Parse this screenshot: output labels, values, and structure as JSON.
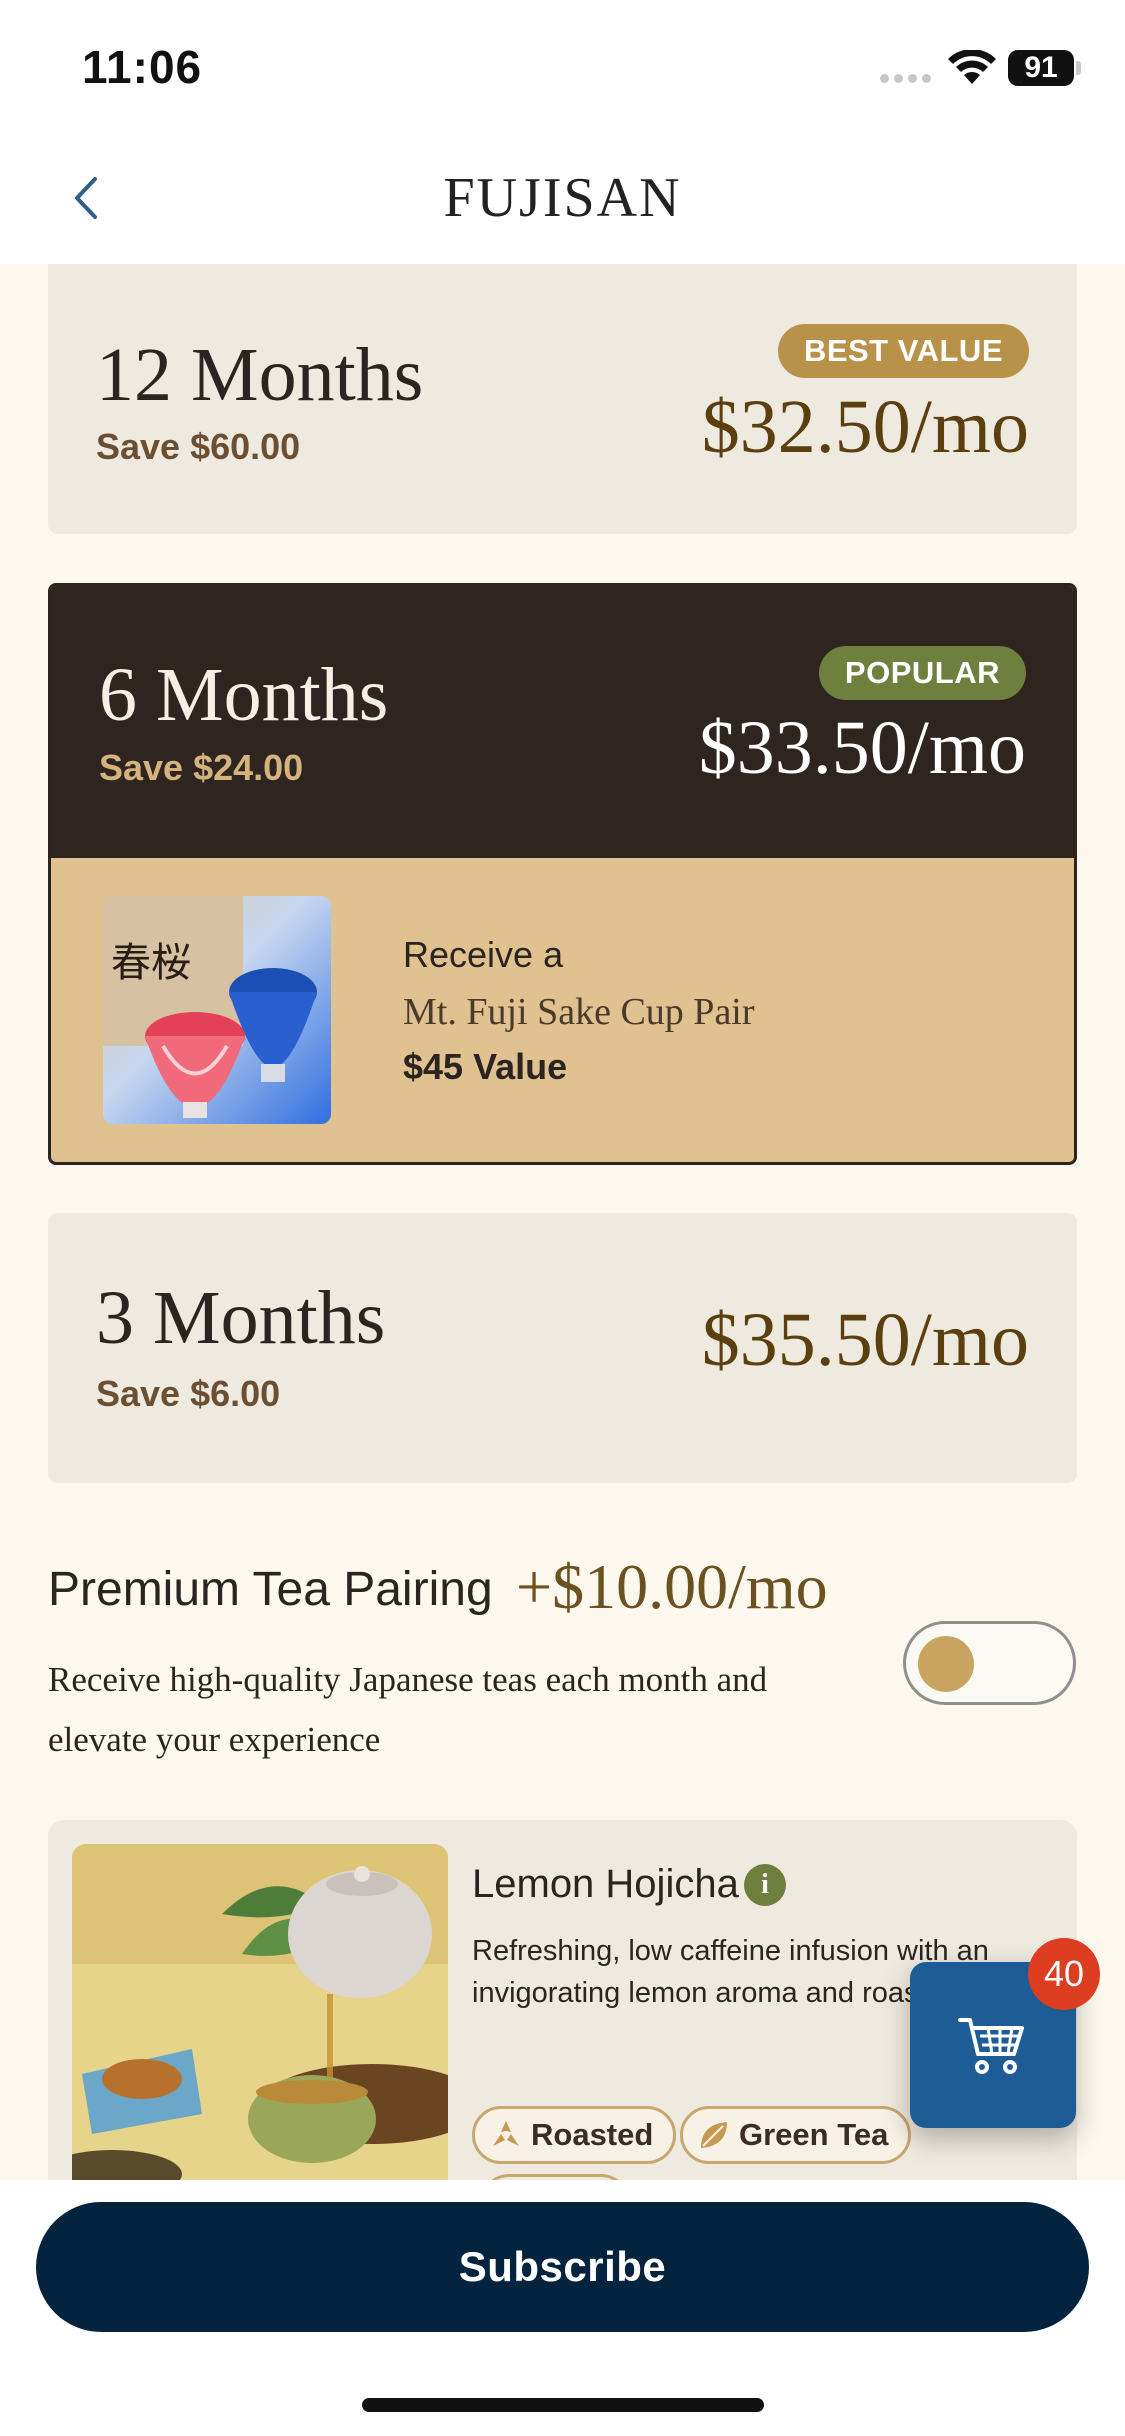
{
  "status_bar": {
    "time": "11:06",
    "battery": "91"
  },
  "nav": {
    "title": "FUJISAN"
  },
  "plans": [
    {
      "name": "12 Months",
      "save": "Save $60.00",
      "price": "$32.50/mo",
      "badge": "BEST VALUE"
    },
    {
      "name": "6 Months",
      "save": "Save $24.00",
      "price": "$33.50/mo",
      "badge": "POPULAR",
      "gift": {
        "line1": "Receive a",
        "line2": "Mt. Fuji Sake Cup Pair",
        "line3": "$45 Value"
      }
    },
    {
      "name": "3 Months",
      "save": "Save $6.00",
      "price": "$35.50/mo"
    }
  ],
  "pairing": {
    "title": "Premium Tea Pairing",
    "price": "+$10.00/mo",
    "description": "Receive high-quality Japanese teas each month and elevate your experience",
    "toggle_on": false
  },
  "tea": {
    "name": "Lemon Hojicha",
    "description": "Refreshing, low caffeine infusion with an invigorating lemon aroma and roasted flavor.",
    "tags": [
      "Roasted",
      "Green Tea"
    ]
  },
  "cart": {
    "count": "40"
  },
  "subscribe_label": "Subscribe",
  "colors": {
    "primary": "#04233e",
    "cart": "#1e5c95",
    "badge_gold": "#b9924a",
    "badge_green": "#6f7f3e",
    "dark_card": "#2e2520"
  },
  "icons": [
    "back-chevron-icon",
    "wifi-icon",
    "battery-icon",
    "info-icon",
    "roasted-icon",
    "leaf-icon",
    "cart-icon"
  ]
}
